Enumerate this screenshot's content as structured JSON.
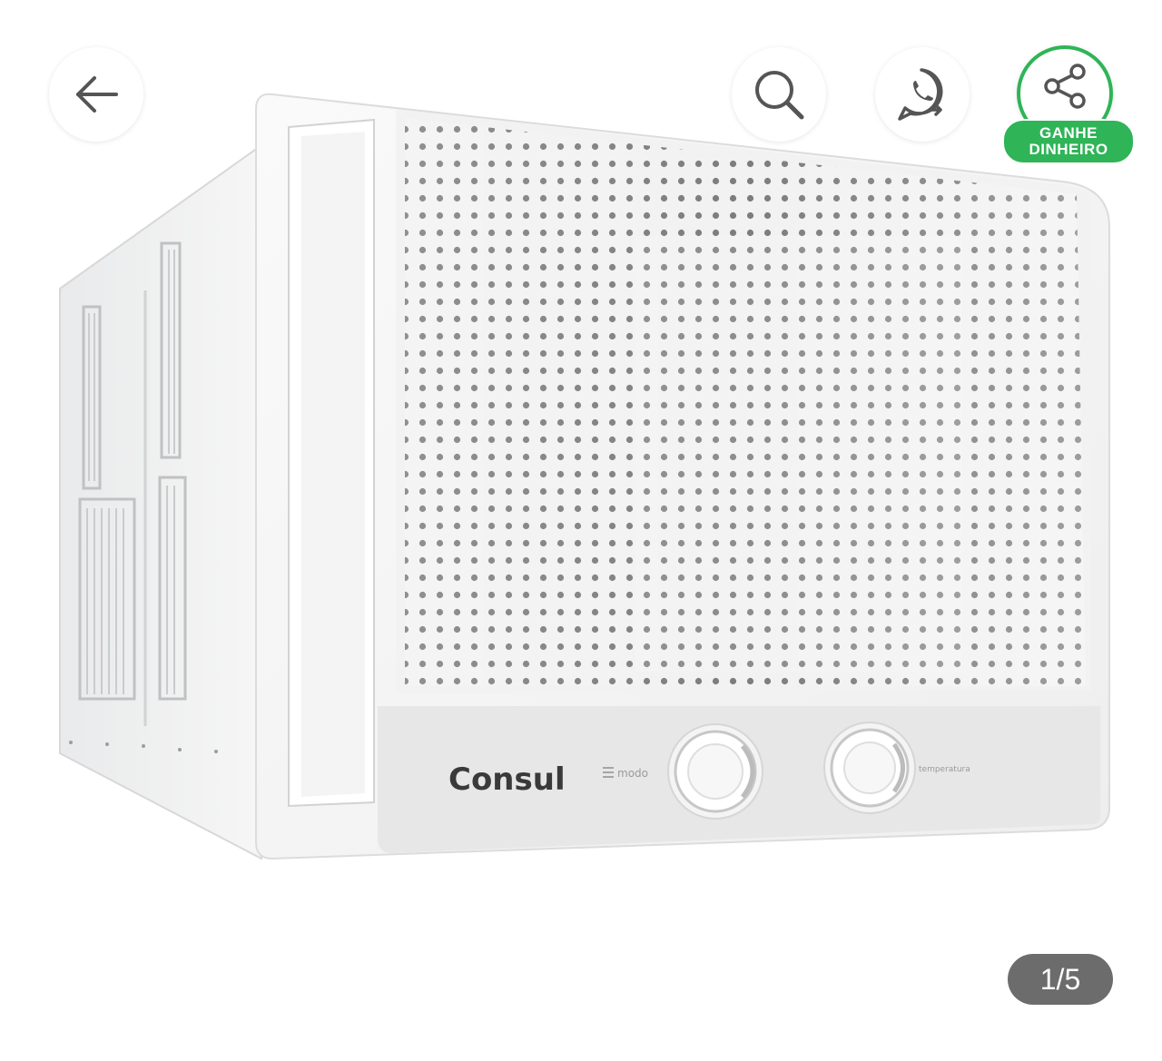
{
  "product_image": {
    "brand_logo_text": "Consul",
    "mode_label": "modo",
    "temperature_label": "temperatura"
  },
  "toolbar": {
    "back_icon": "arrow-left-icon",
    "search_icon": "search-icon",
    "whatsapp_icon": "whatsapp-icon",
    "share_icon": "share-icon",
    "earn_badge_line1": "GANHE",
    "earn_badge_line2": "DINHEIRO"
  },
  "gallery": {
    "counter": "1/5"
  },
  "colors": {
    "accent_green": "#2fb457",
    "counter_bg": "#6c6c6c"
  }
}
